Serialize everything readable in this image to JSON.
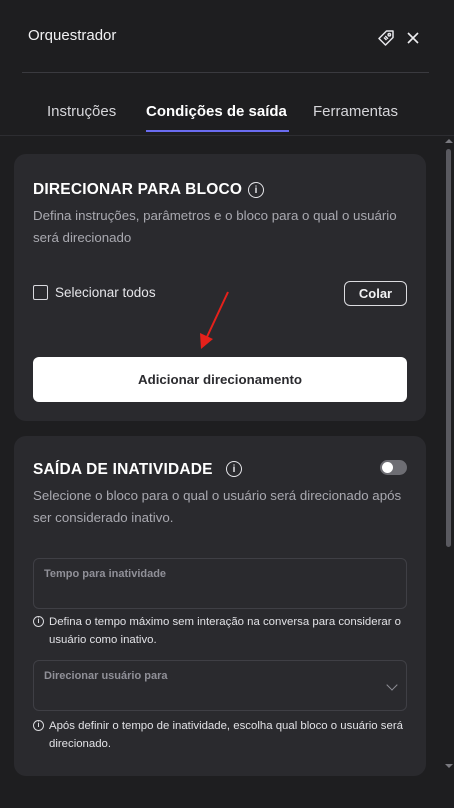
{
  "header": {
    "title": "Orquestrador"
  },
  "tabs": [
    {
      "label": "Instruções",
      "active": false
    },
    {
      "label": "Condições de saída",
      "active": true
    },
    {
      "label": "Ferramentas",
      "active": false
    }
  ],
  "redirect_card": {
    "title": "DIRECIONAR PARA BLOCO",
    "description": "Defina instruções, parâmetros e o bloco para o qual o usuário será direcionado",
    "select_all_label": "Selecionar todos",
    "paste_label": "Colar",
    "add_button_label": "Adicionar direcionamento"
  },
  "inactivity_card": {
    "title": "SAÍDA DE INATIVIDADE",
    "toggle_on": false,
    "description": "Selecione o bloco para o qual o usuário será direcionado após ser considerado inativo.",
    "timeout_field": {
      "label": "Tempo para inatividade",
      "value": ""
    },
    "timeout_hint": "Defina o tempo máximo sem interação na conversa para considerar o usuário como inativo.",
    "redirect_field": {
      "label": "Direcionar usuário para",
      "value": ""
    },
    "redirect_hint": "Após definir o tempo de inatividade, escolha qual bloco o usuário será direcionado."
  },
  "colors": {
    "background": "#1e1e20",
    "card": "#2a2a2e",
    "accent": "#6a6cf0",
    "annotation_arrow": "#e5211b"
  },
  "icons": {
    "tag": "tag-icon",
    "close": "close-icon",
    "info": "info-icon",
    "chevron": "chevron-down-icon"
  }
}
